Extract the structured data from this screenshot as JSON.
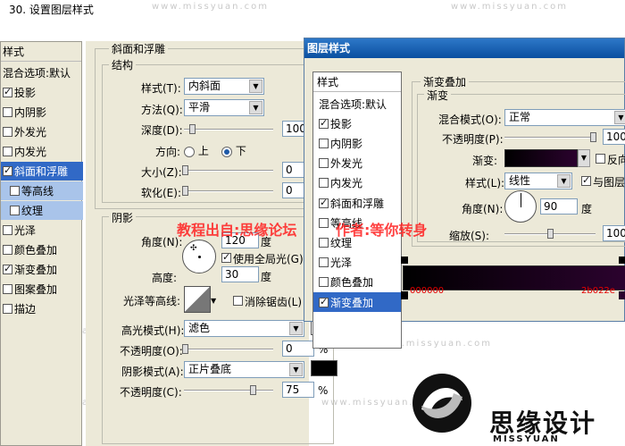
{
  "step_title": "30. 设置图层样式",
  "watermark": "www.missyuan.com",
  "left_panel": {
    "header": "样式",
    "items": [
      {
        "label": "混合选项:默认",
        "checkbox": false,
        "checked": false,
        "state": "normal"
      },
      {
        "label": "投影",
        "checkbox": true,
        "checked": true,
        "state": "normal"
      },
      {
        "label": "内阴影",
        "checkbox": true,
        "checked": false,
        "state": "normal"
      },
      {
        "label": "外发光",
        "checkbox": true,
        "checked": false,
        "state": "normal"
      },
      {
        "label": "内发光",
        "checkbox": true,
        "checked": false,
        "state": "normal"
      },
      {
        "label": "斜面和浮雕",
        "checkbox": true,
        "checked": true,
        "state": "selected"
      },
      {
        "label": "等高线",
        "checkbox": true,
        "checked": false,
        "state": "sub"
      },
      {
        "label": "纹理",
        "checkbox": true,
        "checked": false,
        "state": "sub"
      },
      {
        "label": "光泽",
        "checkbox": true,
        "checked": false,
        "state": "normal"
      },
      {
        "label": "颜色叠加",
        "checkbox": true,
        "checked": false,
        "state": "normal"
      },
      {
        "label": "渐变叠加",
        "checkbox": true,
        "checked": true,
        "state": "normal"
      },
      {
        "label": "图案叠加",
        "checkbox": true,
        "checked": false,
        "state": "normal"
      },
      {
        "label": "描边",
        "checkbox": true,
        "checked": false,
        "state": "normal"
      }
    ]
  },
  "bevel": {
    "group_title": "斜面和浮雕",
    "structure_title": "结构",
    "style_label": "样式(T):",
    "style_value": "内斜面",
    "technique_label": "方法(Q):",
    "technique_value": "平滑",
    "depth_label": "深度(D):",
    "depth_value": "100",
    "direction_label": "方向:",
    "dir_up": "上",
    "dir_down": "下",
    "size_label": "大小(Z):",
    "size_value": "0",
    "soften_label": "软化(E):",
    "soften_value": "0"
  },
  "shading": {
    "title": "阴影",
    "angle_label": "角度(N):",
    "angle_value": "120",
    "angle_unit": "度",
    "global_light_label": "使用全局光(G)",
    "altitude_label": "高度:",
    "altitude_value": "30",
    "altitude_unit": "度",
    "gloss_label": "光泽等高线:",
    "antialias_label": "消除锯齿(L)",
    "highlight_mode_label": "高光模式(H):",
    "highlight_mode_value": "滤色",
    "highlight_opacity_label": "不透明度(O):",
    "highlight_opacity_value": "0",
    "shadow_mode_label": "阴影模式(A):",
    "shadow_mode_value": "正片叠底",
    "shadow_opacity_label": "不透明度(C):",
    "shadow_opacity_value": "75",
    "percent": "%",
    "highlight_color": "#ffffff",
    "shadow_color": "#000000"
  },
  "dialog": {
    "title": "图层样式",
    "list_header": "样式",
    "items": [
      {
        "label": "混合选项:默认",
        "checkbox": false,
        "checked": false,
        "state": "normal"
      },
      {
        "label": "投影",
        "checkbox": true,
        "checked": true,
        "state": "normal"
      },
      {
        "label": "内阴影",
        "checkbox": true,
        "checked": false,
        "state": "normal"
      },
      {
        "label": "外发光",
        "checkbox": true,
        "checked": false,
        "state": "normal"
      },
      {
        "label": "内发光",
        "checkbox": true,
        "checked": false,
        "state": "normal"
      },
      {
        "label": "斜面和浮雕",
        "checkbox": true,
        "checked": true,
        "state": "normal"
      },
      {
        "label": "等高线",
        "checkbox": true,
        "checked": false,
        "state": "normal"
      },
      {
        "label": "纹理",
        "checkbox": true,
        "checked": false,
        "state": "normal"
      },
      {
        "label": "光泽",
        "checkbox": true,
        "checked": false,
        "state": "normal"
      },
      {
        "label": "颜色叠加",
        "checkbox": true,
        "checked": false,
        "state": "normal"
      },
      {
        "label": "渐变叠加",
        "checkbox": true,
        "checked": true,
        "state": "selected"
      }
    ],
    "group_title": "渐变叠加",
    "sub_title": "渐变",
    "blend_label": "混合模式(O):",
    "blend_value": "正常",
    "opacity_label": "不透明度(P):",
    "opacity_value": "100",
    "gradient_label": "渐变:",
    "reverse_label": "反向",
    "style_label": "样式(L):",
    "style_value": "线性",
    "align_label": "与图层",
    "angle_label": "角度(N):",
    "angle_value": "90",
    "angle_unit": "度",
    "scale_label": "缩放(S):",
    "scale_value": "100",
    "gradient_start": "#000000",
    "gradient_end": "#2b022e",
    "stop_start_label": "000000",
    "stop_end_label": "2b022e"
  },
  "overlay_text": {
    "left": "教程出自:思缘论坛",
    "right": "作者:等你转身"
  },
  "logo": {
    "title": "思缘设计",
    "subtitle": "MISSYUAN"
  }
}
